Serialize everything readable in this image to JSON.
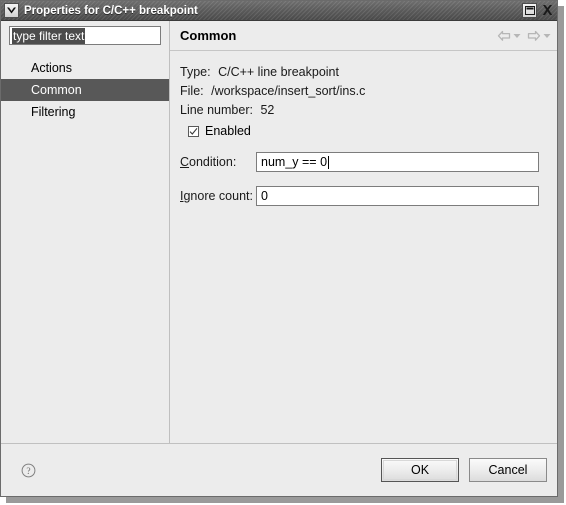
{
  "window": {
    "title": "Properties for C/C++ breakpoint",
    "menu_icon": "chevron-down-icon",
    "buttons": [
      {
        "name": "maximize-button",
        "icon": "maximize-icon",
        "label": "Maximize"
      },
      {
        "name": "close-button",
        "icon": "close-icon",
        "label": "Close"
      }
    ]
  },
  "sidebar": {
    "filter": {
      "value": "type filter text",
      "placeholder": "type filter text",
      "selected": true
    },
    "items": [
      {
        "label": "Actions",
        "selected": false
      },
      {
        "label": "Common",
        "selected": true
      },
      {
        "label": "Filtering",
        "selected": false
      }
    ]
  },
  "page": {
    "title": "Common",
    "nav": {
      "back_label": "Back",
      "forward_label": "Forward",
      "back_icon": "arrow-left-icon",
      "forward_icon": "arrow-right-icon",
      "dropdown_icon": "chevron-down-icon"
    },
    "info": [
      {
        "label": "Type:",
        "value": "C/C++ line breakpoint"
      },
      {
        "label": "File:",
        "value": "/workspace/insert_sort/ins.c"
      },
      {
        "label": "Line number:",
        "value": "52"
      }
    ],
    "enabled": {
      "label": "Enabled",
      "checked": true
    },
    "fields": [
      {
        "mnemonic": "C",
        "label_rest": "ondition:",
        "value": "num_y == 0",
        "focused": true
      },
      {
        "mnemonic": "I",
        "label_rest": "gnore count:",
        "value": "0",
        "focused": false
      }
    ]
  },
  "footer": {
    "help_icon": "help-icon",
    "help_label": "Help",
    "ok_label": "OK",
    "cancel_label": "Cancel"
  },
  "colors": {
    "titlebar": "#5c5c5c",
    "dialog_bg": "#ececec",
    "selection": "#585858",
    "field_border": "#7c7c7c",
    "text": "#000000"
  }
}
